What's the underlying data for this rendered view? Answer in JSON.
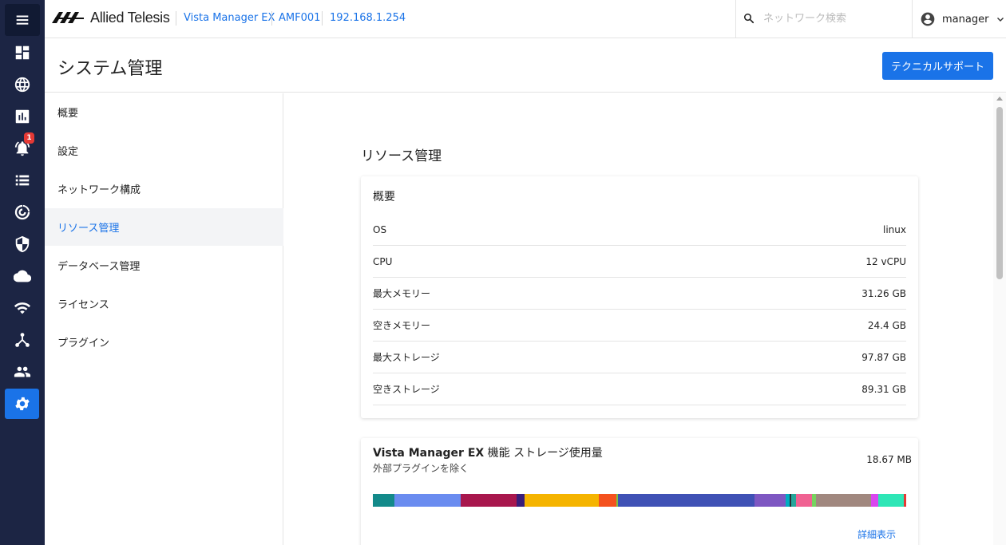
{
  "app": {
    "brand": "Allied Telesis",
    "breadcrumb": [
      "Vista Manager EX",
      "AMF001",
      "192.168.1.254"
    ]
  },
  "search": {
    "placeholder": "ネットワーク検索"
  },
  "user": {
    "name": "manager"
  },
  "rail": {
    "icons": [
      "menu-icon",
      "dashboard-icon",
      "globe-icon",
      "chart-icon",
      "alarm-bell-icon",
      "list-icon",
      "radar-icon",
      "shield-icon",
      "cloud-icon",
      "wifi-icon",
      "topology-icon",
      "people-icon",
      "settings-gear-icon"
    ],
    "alarm_count": "1",
    "active": "settings-gear-icon"
  },
  "page": {
    "title": "システム管理",
    "support_button": "テクニカルサポート"
  },
  "subnav": {
    "items": [
      {
        "label": "概要"
      },
      {
        "label": "設定"
      },
      {
        "label": "ネットワーク構成"
      },
      {
        "label": "リソース管理"
      },
      {
        "label": "データベース管理"
      },
      {
        "label": "ライセンス"
      },
      {
        "label": "プラグイン"
      }
    ],
    "active": "リソース管理"
  },
  "main": {
    "section_title": "リソース管理",
    "overview": {
      "title": "概要",
      "rows": [
        {
          "label": "OS",
          "value": "linux"
        },
        {
          "label": "CPU",
          "value": "12 vCPU"
        },
        {
          "label": "最大メモリー",
          "value": "31.26 GB"
        },
        {
          "label": "空きメモリー",
          "value": "24.4 GB"
        },
        {
          "label": "最大ストレージ",
          "value": "97.87 GB"
        },
        {
          "label": "空きストレージ",
          "value": "89.31 GB"
        }
      ]
    },
    "storage": {
      "title_bold": "Vista Manager EX",
      "title_rest": " 機能 ストレージ使用量",
      "subtitle": "外部プラグインを除く",
      "total": "18.67 MB",
      "details_link": "詳細表示",
      "segments": [
        {
          "color": "#138a8a",
          "share": 4.0
        },
        {
          "color": "#6a8cf0",
          "share": 12.4
        },
        {
          "color": "#a8174d",
          "share": 10.3
        },
        {
          "color": "#3a1e7a",
          "share": 1.6
        },
        {
          "color": "#f5b400",
          "share": 13.7
        },
        {
          "color": "#f4511e",
          "share": 3.4
        },
        {
          "color": "#7cc243",
          "share": 0.3
        },
        {
          "color": "#3f51b5",
          "share": 25.4
        },
        {
          "color": "#7e57c2",
          "share": 5.8
        },
        {
          "color": "#00acc1",
          "share": 0.7
        },
        {
          "color": "#263238",
          "share": 0.3
        },
        {
          "color": "#26a69a",
          "share": 0.9
        },
        {
          "color": "#f06292",
          "share": 3.0
        },
        {
          "color": "#76d35f",
          "share": 0.7
        },
        {
          "color": "#a1887f",
          "share": 10.3
        },
        {
          "color": "#d946ef",
          "share": 1.3
        },
        {
          "color": "#2ee6b6",
          "share": 4.8
        },
        {
          "color": "#e53935",
          "share": 0.4
        }
      ]
    }
  }
}
